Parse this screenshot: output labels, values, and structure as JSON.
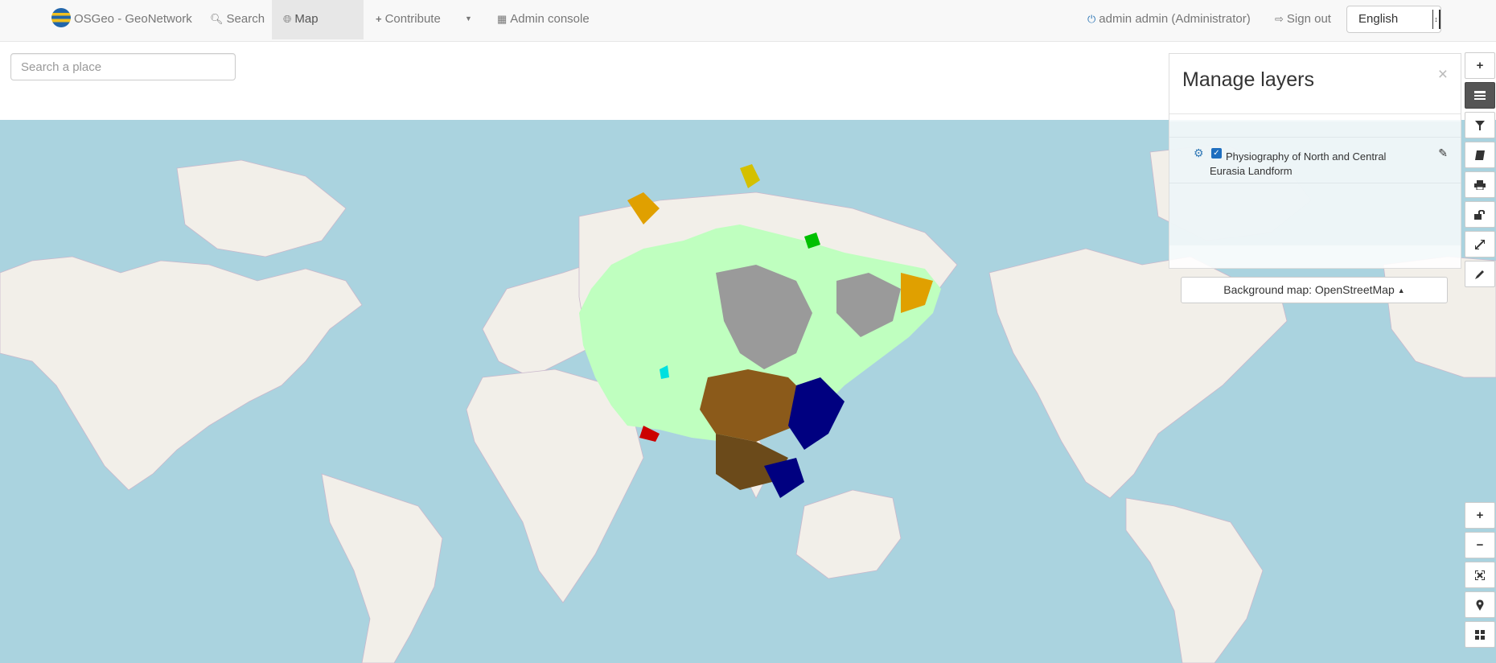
{
  "navbar": {
    "brand": "OSGeo - GeoNetwork",
    "search": "Search",
    "map": "Map",
    "contribute": "Contribute",
    "admin_console": "Admin console",
    "user": "admin admin (Administrator)",
    "sign_out": "Sign out",
    "language": "English"
  },
  "search": {
    "placeholder": "Search a place"
  },
  "panel": {
    "title": "Manage layers",
    "close": "×",
    "layers": [
      {
        "name": "Physiography of North and Central Eurasia Landform",
        "checked": true
      }
    ],
    "background_button": "Background map: OpenStreetMap"
  },
  "toolbar": {
    "top": [
      "plus-icon",
      "layers-icon",
      "filter-icon",
      "book-icon",
      "print-icon",
      "share-icon",
      "resize-icon",
      "pencil-icon"
    ],
    "bottom": [
      "zoom-in-icon",
      "zoom-out-icon",
      "fullscreen-icon",
      "location-icon",
      "grid-icon"
    ]
  },
  "colors": {
    "navbar_bg": "#f8f8f8",
    "ocean": "#aad3df",
    "land": "#f2efe9",
    "layer_main": "#bfffbf",
    "accent": "#337ab7"
  }
}
